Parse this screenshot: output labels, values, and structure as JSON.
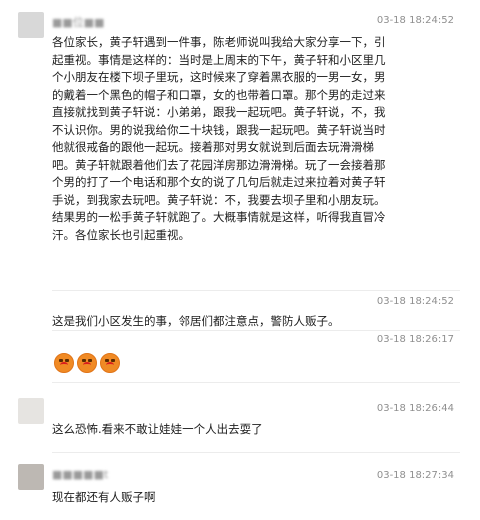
{
  "comments": [
    {
      "user": "■■位■■",
      "time": "03-18 18:24:52",
      "text": "各位家长，黄子轩遇到一件事，陈老师说叫我给大家分享一下，引起重视。事情是这样的：当时是上周末的下午，黄子轩和小区里几个小朋友在楼下坝子里玩，这时候来了穿着黑衣服的一男一女，男的戴着一个黑色的帽子和口罩，女的也带着口罩。那个男的走过来直接就找到黄子轩说：小弟弟，跟我一起玩吧。黄子轩说，不，我不认识你。男的说我给你二十块钱，跟我一起玩吧。黄子轩说当时他就很戒备的跟他一起玩。接着那对男女就说到后面去玩滑滑梯吧。黄子轩就跟着他们去了花园洋房那边滑滑梯。玩了一会接着那个男的打了一个电话和那个女的说了几句后就走过来拉着对黄子轩手说，到我家去玩吧。黄子轩说：不，我要去坝子里和小朋友玩。结果男的一松手黄子轩就跑了。大概事情就是这样，听得我直冒冷汗。各位家长也引起重视。"
    },
    {
      "user": "",
      "time": "03-18 18:24:52",
      "text": "这是我们小区发生的事，邻居们都注意点，警防人贩子。"
    },
    {
      "user": "",
      "time": "03-18 18:26:17",
      "emojis": [
        "angry-face",
        "angry-face",
        "angry-face"
      ]
    },
    {
      "user": "",
      "time": "03-18 18:26:44",
      "text": "这么恐怖.看来不敢让娃娃一个人出去耍了"
    },
    {
      "user": "■■■■■t",
      "time": "03-18 18:27:34",
      "text": "现在都还有人贩子啊"
    }
  ]
}
